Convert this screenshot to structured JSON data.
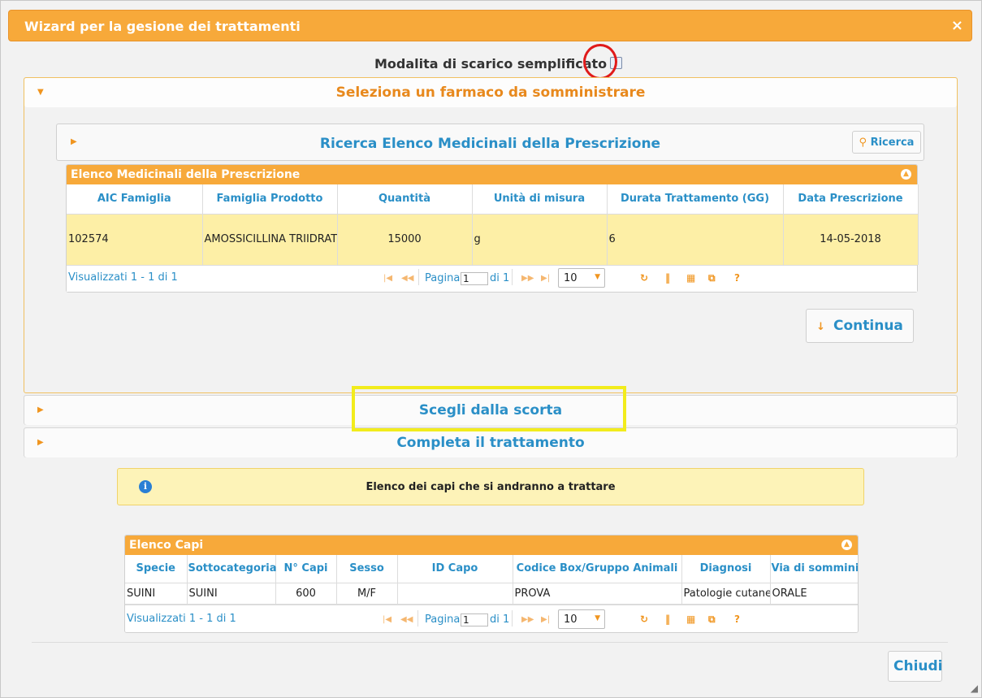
{
  "dialog": {
    "title": "Wizard per la gesione dei trattamenti",
    "close_glyph": "×",
    "simplified_mode_label": "Modalita di scarico semplificato",
    "simplified_mode_checked": false
  },
  "sections": {
    "select_drug": "Seleziona un farmaco da somministrare",
    "choose_stock": "Scegli dalla scorta",
    "complete_treatment": "Completa il trattamento"
  },
  "search_panel": {
    "title": "Ricerca Elenco Medicinali della Prescrizione",
    "search_button": "Ricerca",
    "search_icon": "search-icon"
  },
  "prescription_grid": {
    "caption": "Elenco Medicinali della Prescrizione",
    "columns": [
      "AIC Famiglia",
      "Famiglia Prodotto",
      "Quantità",
      "Unità di misura",
      "Durata Trattamento (GG)",
      "Data Prescrizione"
    ],
    "rows": [
      [
        "102574",
        "AMOSSICILLINA TRIIDRATO",
        "15000",
        "g",
        "6",
        "14-05-2018"
      ]
    ],
    "pager": {
      "info": "Visualizzati 1 - 1 di 1",
      "page_label": "Pagina",
      "page_value": "1",
      "of_label": "di 1",
      "page_size": "10"
    }
  },
  "continue_button": "Continua",
  "info_message": "Elenco dei capi che si andranno a trattare",
  "animals_grid": {
    "caption": "Elenco Capi",
    "columns": [
      "Specie",
      "Sottocategoria",
      "N° Capi",
      "Sesso",
      "ID Capo",
      "Codice Box/Gruppo Animali",
      "Diagnosi",
      "Via di somminis"
    ],
    "rows": [
      [
        "SUINI",
        "SUINI",
        "600",
        "M/F",
        "",
        "PROVA",
        "Patologie cutanee",
        "ORALE"
      ]
    ],
    "pager": {
      "info": "Visualizzati 1 - 1 di 1",
      "page_label": "Pagina",
      "page_value": "1",
      "of_label": "di 1",
      "page_size": "10"
    }
  },
  "close_button": "Chiudi",
  "colors": {
    "accent_orange": "#f7a93a",
    "link_blue": "#2a8fc7",
    "selected_row": "#fdefa6",
    "annotation_red": "#e01a1a",
    "annotation_yellow": "#f2ec1c"
  }
}
